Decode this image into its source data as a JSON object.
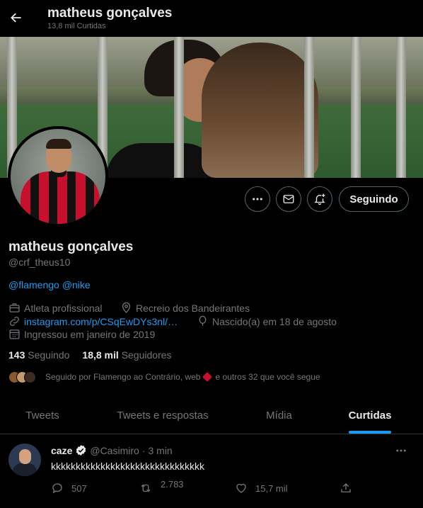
{
  "header": {
    "title": "matheus gonçalves",
    "subtitle": "13,8 mil Curtidas"
  },
  "profile": {
    "name": "matheus gonçalves",
    "handle": "@crf_theus10",
    "bio_links": [
      "@flamengo",
      "@nike"
    ],
    "category": "Atleta profissional",
    "location": "Recreio dos Bandeirantes",
    "website": "instagram.com/p/CSqEwDYs3nl/…",
    "birthday": "Nascido(a) em 18 de agosto",
    "joined": "Ingressou em janeiro de 2019",
    "following_count": "143",
    "following_label": "Seguindo",
    "followers_count": "18,8 mil",
    "followers_label": "Seguidores",
    "followed_by_a": "Seguido por Flamengo ao Contrário, web",
    "followed_by_b": "e outros 32 que você segue"
  },
  "actions": {
    "follow_button": "Seguindo"
  },
  "tabs": [
    "Tweets",
    "Tweets e respostas",
    "Mídia",
    "Curtidas"
  ],
  "active_tab": "Curtidas",
  "tweet": {
    "name": "caze",
    "handle": "@Casimiro",
    "separator": "·",
    "time": "3 min",
    "text": "kkkkkkkkkkkkkkkkkkkkkkkkkkkkkkk",
    "replies": "507",
    "retweets": "2.783",
    "likes": "15,7 mil"
  },
  "colors": {
    "background": "#000000",
    "accent": "#1d9bf0",
    "muted": "#71767b",
    "text": "#e7e9ea",
    "verified_badge": "#e7e9ea"
  }
}
